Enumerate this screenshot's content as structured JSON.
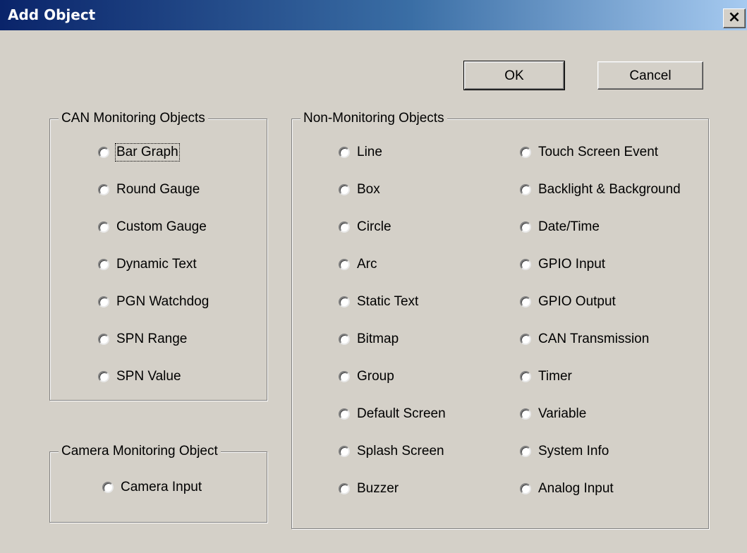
{
  "window": {
    "title": "Add Object",
    "close_glyph": "✕",
    "close_icon": "close-icon"
  },
  "buttons": {
    "ok": "OK",
    "cancel": "Cancel"
  },
  "can_group": {
    "label": "CAN Monitoring Objects",
    "items": [
      "Bar Graph",
      "Round Gauge",
      "Custom Gauge",
      "Dynamic Text",
      "PGN Watchdog",
      "SPN Range",
      "SPN Value"
    ]
  },
  "camera_group": {
    "label": "Camera Monitoring Object",
    "items": [
      "Camera Input"
    ]
  },
  "non_group": {
    "label": "Non-Monitoring Objects",
    "left_items": [
      "Line",
      "Box",
      "Circle",
      "Arc",
      "Static Text",
      "Bitmap",
      "Group",
      "Default Screen",
      "Splash Screen",
      "Buzzer"
    ],
    "right_items": [
      "Touch Screen Event",
      "Backlight & Background",
      "Date/Time",
      "GPIO Input",
      "GPIO Output",
      "CAN Transmission",
      "Timer",
      "Variable",
      "System Info",
      "Analog Input"
    ]
  }
}
